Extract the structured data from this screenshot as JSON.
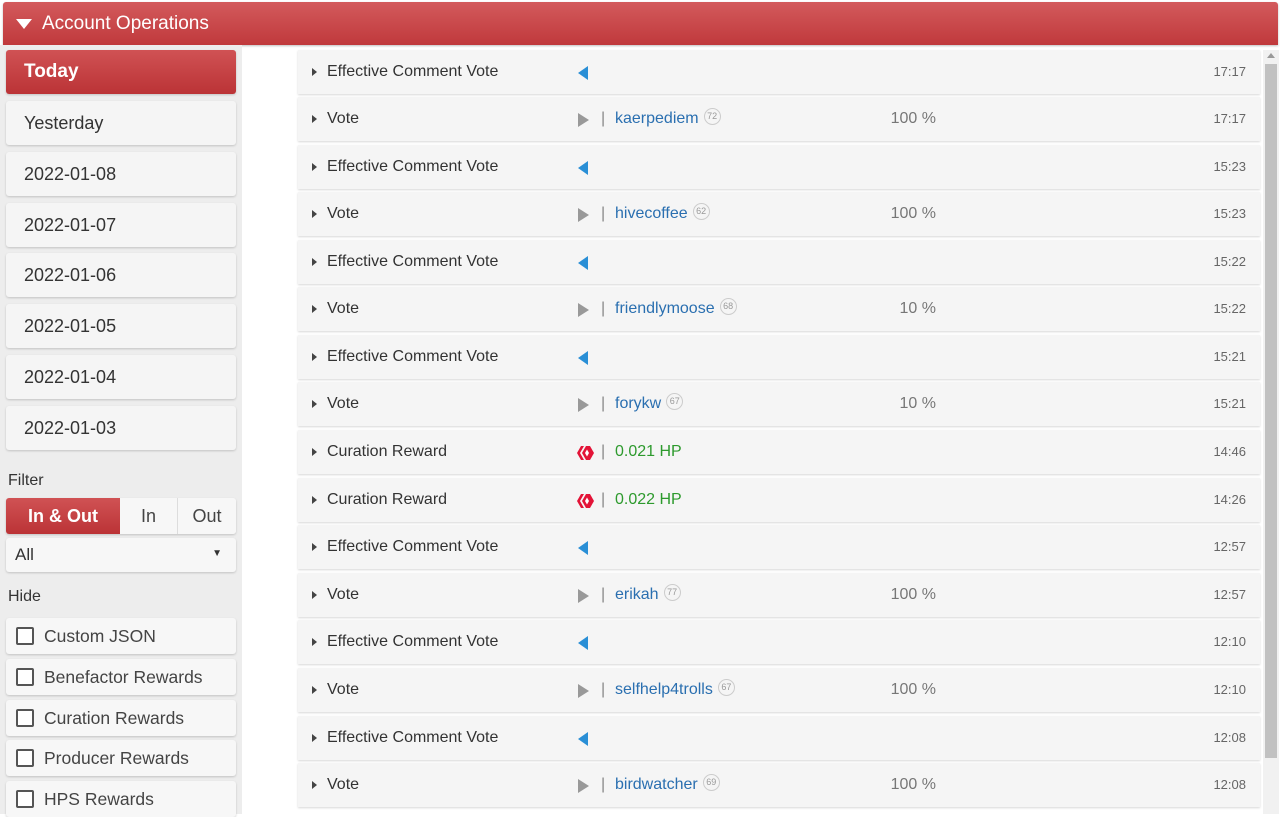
{
  "header": {
    "title": "Account Operations"
  },
  "sidebar": {
    "days": [
      "Today",
      "Yesterday",
      "2022-01-08",
      "2022-01-07",
      "2022-01-06",
      "2022-01-05",
      "2022-01-04",
      "2022-01-03"
    ],
    "filter_label": "Filter",
    "filter_options": {
      "inout": "In & Out",
      "in": "In",
      "out": "Out"
    },
    "select_value": "All",
    "hide_label": "Hide",
    "hide_items": [
      "Custom JSON",
      "Benefactor Rewards",
      "Curation Rewards",
      "Producer Rewards",
      "HPS Rewards"
    ]
  },
  "operations": [
    {
      "op": "Effective Comment Vote",
      "icon": "blue-left-triangle-icon",
      "time": "17:17"
    },
    {
      "op": "Vote",
      "icon": "gray-right-triangle-icon",
      "sep": "|",
      "account": "kaerpediem",
      "rep": "72",
      "pct": "100 %",
      "time": "17:17"
    },
    {
      "op": "Effective Comment Vote",
      "icon": "blue-left-triangle-icon",
      "time": "15:23"
    },
    {
      "op": "Vote",
      "icon": "gray-right-triangle-icon",
      "sep": "|",
      "account": "hivecoffee",
      "rep": "62",
      "pct": "100 %",
      "time": "15:23"
    },
    {
      "op": "Effective Comment Vote",
      "icon": "blue-left-triangle-icon",
      "time": "15:22"
    },
    {
      "op": "Vote",
      "icon": "gray-right-triangle-icon",
      "sep": "|",
      "account": "friendlymoose",
      "rep": "68",
      "pct": "10 %",
      "time": "15:22"
    },
    {
      "op": "Effective Comment Vote",
      "icon": "blue-left-triangle-icon",
      "time": "15:21"
    },
    {
      "op": "Vote",
      "icon": "gray-right-triangle-icon",
      "sep": "|",
      "account": "forykw",
      "rep": "67",
      "pct": "10 %",
      "time": "15:21"
    },
    {
      "op": "Curation Reward",
      "icon": "hive-logo-icon",
      "sep": "|",
      "amount": "0.021 HP",
      "time": "14:46"
    },
    {
      "op": "Curation Reward",
      "icon": "hive-logo-icon",
      "sep": "|",
      "amount": "0.022 HP",
      "time": "14:26"
    },
    {
      "op": "Effective Comment Vote",
      "icon": "blue-left-triangle-icon",
      "time": "12:57"
    },
    {
      "op": "Vote",
      "icon": "gray-right-triangle-icon",
      "sep": "|",
      "account": "erikah",
      "rep": "77",
      "pct": "100 %",
      "time": "12:57"
    },
    {
      "op": "Effective Comment Vote",
      "icon": "blue-left-triangle-icon",
      "time": "12:10"
    },
    {
      "op": "Vote",
      "icon": "gray-right-triangle-icon",
      "sep": "|",
      "account": "selfhelp4trolls",
      "rep": "67",
      "pct": "100 %",
      "time": "12:10"
    },
    {
      "op": "Effective Comment Vote",
      "icon": "blue-left-triangle-icon",
      "time": "12:08"
    },
    {
      "op": "Vote",
      "icon": "gray-right-triangle-icon",
      "sep": "|",
      "account": "birdwatcher",
      "rep": "69",
      "pct": "100 %",
      "time": "12:08"
    }
  ],
  "colors": {
    "accent": "#c0393c",
    "link": "#2a6fb0",
    "amount": "#2d9a2d",
    "vote_icon": "#2a8fd6",
    "hive_logo": "#e31337"
  }
}
